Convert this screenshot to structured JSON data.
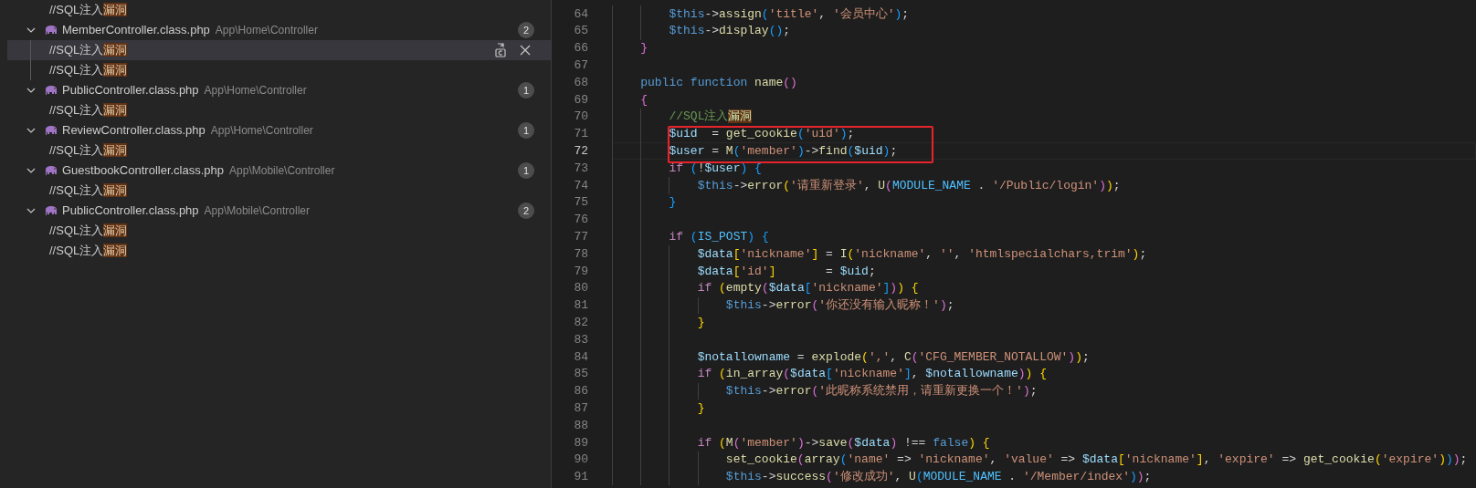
{
  "search_results": {
    "partial_matches": [
      {
        "before": "//SQL注入",
        "match": "漏洞",
        "selected": false
      }
    ],
    "files": [
      {
        "name": "MemberController.class.php",
        "path": "App\\Home\\Controller",
        "count": "2",
        "expanded": true,
        "matches": [
          {
            "before": "//SQL注入",
            "match": "漏洞",
            "selected": true
          },
          {
            "before": "//SQL注入",
            "match": "漏洞",
            "selected": false
          }
        ]
      },
      {
        "name": "PublicController.class.php",
        "path": "App\\Home\\Controller",
        "count": "1",
        "expanded": true,
        "matches": [
          {
            "before": "//SQL注入",
            "match": "漏洞",
            "selected": false
          }
        ]
      },
      {
        "name": "ReviewController.class.php",
        "path": "App\\Home\\Controller",
        "count": "1",
        "expanded": true,
        "matches": [
          {
            "before": "//SQL注入",
            "match": "漏洞",
            "selected": false
          }
        ]
      },
      {
        "name": "GuestbookController.class.php",
        "path": "App\\Mobile\\Controller",
        "count": "1",
        "expanded": true,
        "matches": [
          {
            "before": "//SQL注入",
            "match": "漏洞",
            "selected": false
          }
        ]
      },
      {
        "name": "PublicController.class.php",
        "path": "App\\Mobile\\Controller",
        "count": "2",
        "expanded": true,
        "matches": [
          {
            "before": "//SQL注入",
            "match": "漏洞",
            "selected": false
          },
          {
            "before": "//SQL注入",
            "match": "漏洞",
            "selected": false
          }
        ]
      }
    ]
  },
  "editor": {
    "lines": [
      {
        "number": "64",
        "code": "        $this->assign('title', '会员中心');",
        "current": false
      },
      {
        "number": "65",
        "code": "        $this->display();",
        "current": false
      },
      {
        "number": "66",
        "code": "    }",
        "current": false
      },
      {
        "number": "67",
        "current": false
      },
      {
        "number": "68",
        "code": "    public function name()",
        "current": false
      },
      {
        "number": "69",
        "code": "    {",
        "current": false
      },
      {
        "number": "70",
        "code": "        //SQL注入",
        "match": "漏洞",
        "current": false
      },
      {
        "number": "71",
        "code": "        $uid  = get_cookie('uid');",
        "current": false
      },
      {
        "number": "72",
        "code": "        $user = M('member')->find($uid);",
        "current": true
      },
      {
        "number": "73",
        "code": "        if (!$user) {",
        "current": false
      },
      {
        "number": "74",
        "code": "            $this->error('请重新登录', U(MODULE_NAME . '/Public/login'));",
        "current": false
      },
      {
        "number": "75",
        "code": "        }",
        "current": false
      },
      {
        "number": "76",
        "current": false
      },
      {
        "number": "77",
        "code": "        if (IS_POST) {",
        "current": false
      },
      {
        "number": "78",
        "code": "            $data['nickname'] = I('nickname', '', 'htmlspecialchars,trim');",
        "current": false
      },
      {
        "number": "79",
        "code": "            $data['id']       = $uid;",
        "current": false
      },
      {
        "number": "80",
        "code": "            if (empty($data['nickname'])) {",
        "current": false
      },
      {
        "number": "81",
        "code": "                $this->error('你还没有输入昵称！');",
        "current": false
      },
      {
        "number": "82",
        "code": "            }",
        "current": false
      },
      {
        "number": "83",
        "current": false
      },
      {
        "number": "84",
        "code": "            $notallowname = explode(',', C('CFG_MEMBER_NOTALLOW'));",
        "current": false
      },
      {
        "number": "85",
        "code": "            if (in_array($data['nickname'], $notallowname)) {",
        "current": false
      },
      {
        "number": "86",
        "code": "                $this->error('此昵称系统禁用，请重新更换一个！');",
        "current": false
      },
      {
        "number": "87",
        "code": "            }",
        "current": false
      },
      {
        "number": "88",
        "current": false
      },
      {
        "number": "89",
        "code": "            if (M('member')->save($data) !== false) {",
        "current": false
      },
      {
        "number": "90",
        "code": "                set_cookie(array('name' => 'nickname', 'value' => $data['nickname'], 'expire' => get_cookie('expire')));",
        "current": false
      },
      {
        "number": "91",
        "code": "                $this->success('修改成功', U(MODULE_NAME . '/Member/index'));",
        "current": false
      }
    ]
  }
}
